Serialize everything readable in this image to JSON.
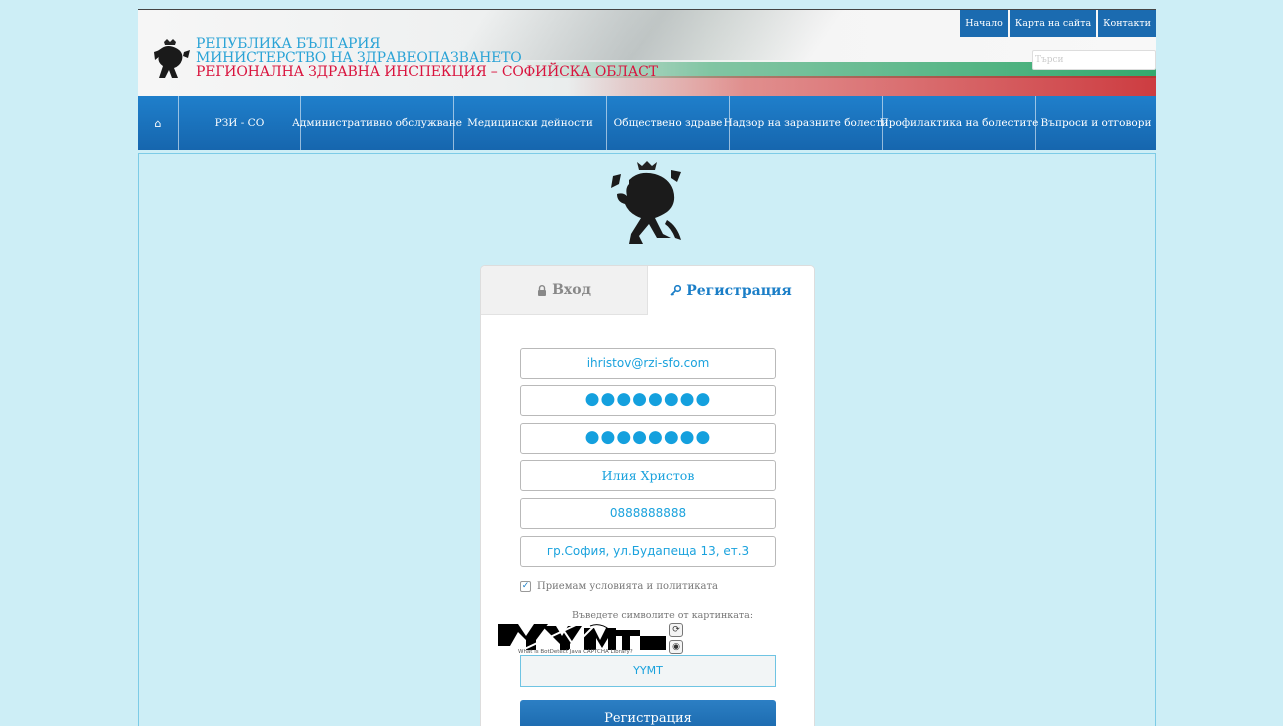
{
  "header": {
    "title_line1": "РЕПУБЛИКА БЪЛГАРИЯ",
    "title_line2": "МИНИСТЕРСТВО НА ЗДРАВЕОПАЗВАНЕТО",
    "title_line3": "РЕГИОНАЛНА ЗДРАВНА ИНСПЕКЦИЯ – СОФИЙСКА ОБЛАСТ",
    "top_links": [
      "Начало",
      "Карта на сайта",
      "Контакти"
    ],
    "search_placeholder": "Търси"
  },
  "nav": {
    "home_icon": "⌂",
    "items": [
      "РЗИ - СО",
      "Административно обслужване",
      "Медицински дейности",
      "Обществено здраве",
      "Надзор на заразните болести",
      "Профилактика на болестите",
      "Въпроси и отговори"
    ]
  },
  "tabs": {
    "login": "Вход",
    "register": "Регистрация"
  },
  "form": {
    "email": "ihristov@rzi-sfo.com",
    "password": "●●●●●●●●",
    "password_confirm": "●●●●●●●●",
    "name": "Илия Христов",
    "phone": "0888888888",
    "address": "гр.София, ул.Будапеща 13, ет.3",
    "accept_terms": "Приемам условията и политиката",
    "accept_checked": true,
    "captcha_label": "Въведете символите от картинката:",
    "captcha_note": "What is BotDetect Java CAPTCHA Library?",
    "captcha_value": "YYMT",
    "submit": "Регистрация"
  },
  "colors": {
    "accent": "#1a7ec7",
    "nav": "#1666ae",
    "brand_red": "#d9143e",
    "brand_blue": "#2aa3d6",
    "background": "#cdeef6"
  }
}
